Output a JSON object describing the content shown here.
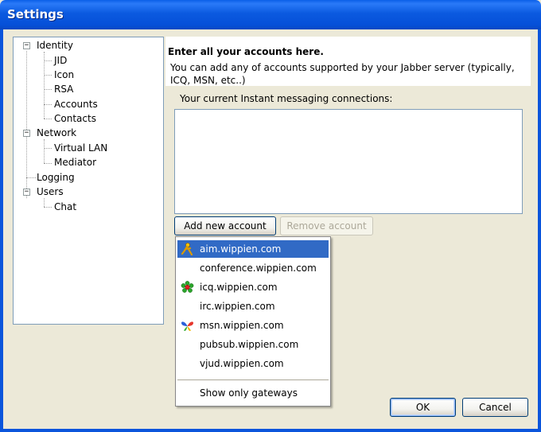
{
  "window": {
    "title": "Settings"
  },
  "tree": {
    "items": [
      {
        "label": "Identity",
        "expander": "−"
      },
      {
        "label": "JID"
      },
      {
        "label": "Icon"
      },
      {
        "label": "RSA"
      },
      {
        "label": "Accounts"
      },
      {
        "label": "Contacts"
      },
      {
        "label": "Network",
        "expander": "−"
      },
      {
        "label": "Virtual LAN"
      },
      {
        "label": "Mediator"
      },
      {
        "label": "Logging"
      },
      {
        "label": "Users",
        "expander": "−"
      },
      {
        "label": "Chat"
      }
    ]
  },
  "header": {
    "title": "Enter all your accounts here.",
    "description": "You can add any of accounts supported by your Jabber server (typically, ICQ, MSN, etc..)"
  },
  "connections": {
    "label": "Your current Instant messaging connections:"
  },
  "buttons": {
    "add": "Add new account",
    "remove": "Remove account",
    "ok": "OK",
    "cancel": "Cancel"
  },
  "menu": {
    "items": [
      {
        "label": "aim.wippien.com",
        "icon": "aim-icon",
        "selected": true
      },
      {
        "label": "conference.wippien.com"
      },
      {
        "label": "icq.wippien.com",
        "icon": "icq-flower-icon"
      },
      {
        "label": "irc.wippien.com"
      },
      {
        "label": "msn.wippien.com",
        "icon": "msn-butterfly-icon"
      },
      {
        "label": "pubsub.wippien.com"
      },
      {
        "label": "vjud.wippien.com"
      }
    ],
    "footer": "Show only gateways"
  },
  "colors": {
    "titlebar": "#0a5fe8",
    "selection": "#316ac5",
    "dialog_bg": "#ece9d8"
  }
}
